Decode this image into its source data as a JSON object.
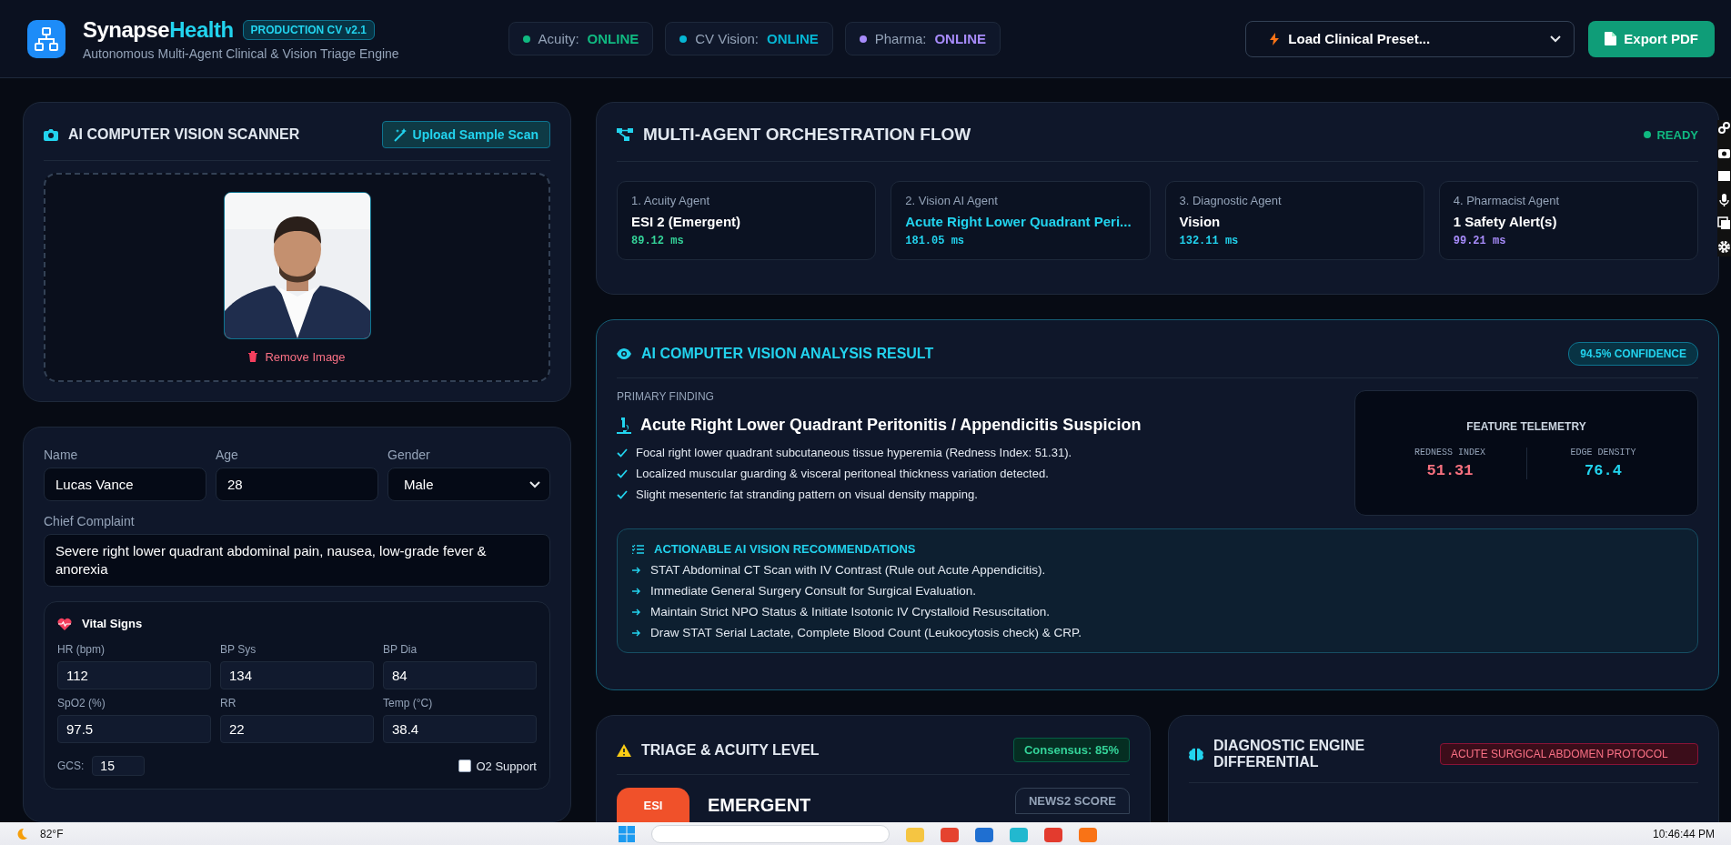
{
  "header": {
    "app_name_part1": "Synapse",
    "app_name_part2": "Health",
    "version_badge": "PRODUCTION CV v2.1",
    "subtitle": "Autonomous Multi-Agent Clinical & Vision Triage Engine"
  },
  "status_pills": [
    {
      "label": "Acuity:",
      "status": "ONLINE",
      "color": "#10b981"
    },
    {
      "label": "CV Vision:",
      "status": "ONLINE",
      "color": "#06b6d4"
    },
    {
      "label": "Pharma:",
      "status": "ONLINE",
      "color": "#a78bfa"
    }
  ],
  "preset_select": {
    "value": "Load Clinical Preset..."
  },
  "export_button": {
    "label": "Export PDF"
  },
  "scanner": {
    "title": "AI COMPUTER VISION SCANNER",
    "upload_button": "Upload Sample Scan",
    "remove_link": "Remove Image"
  },
  "patient_form": {
    "fields": [
      {
        "label": "Name",
        "value": "Lucas Vance",
        "kind": "text"
      },
      {
        "label": "Age",
        "value": "28",
        "kind": "text"
      },
      {
        "label": "Gender",
        "value": "Male",
        "kind": "select"
      }
    ],
    "chief_complaint": {
      "label": "Chief Complaint",
      "value": "Severe right lower quadrant abdominal pain, nausea, low-grade fever & anorexia"
    },
    "vitals": {
      "title": "Vital Signs",
      "fields": [
        {
          "label": "HR (bpm)",
          "value": "112"
        },
        {
          "label": "BP Sys",
          "value": "134"
        },
        {
          "label": "BP Dia",
          "value": "84"
        },
        {
          "label": "SpO2 (%)",
          "value": "97.5"
        },
        {
          "label": "RR",
          "value": "22"
        },
        {
          "label": "Temp (°C)",
          "value": "38.4"
        }
      ],
      "gcs": {
        "label": "GCS:",
        "value": "15"
      },
      "o2_support": {
        "label": "O2 Support",
        "checked": false
      }
    }
  },
  "orchestration": {
    "title": "MULTI-AGENT ORCHESTRATION FLOW",
    "status": "READY",
    "agents": [
      {
        "step": "1. Acuity Agent",
        "result": "ESI 2 (Emergent)",
        "latency": "89.12 ms",
        "color": "#34d399",
        "highlighted": false
      },
      {
        "step": "2. Vision AI Agent",
        "result": "Acute Right Lower Quadrant Peri...",
        "latency": "181.05 ms",
        "color": "#22d3ee",
        "highlighted": true
      },
      {
        "step": "3. Diagnostic Agent",
        "result": "Vision",
        "latency": "132.11 ms",
        "color": "#22d3ee",
        "highlighted": false
      },
      {
        "step": "4. Pharmacist Agent",
        "result": "1 Safety Alert(s)",
        "latency": "99.21 ms",
        "color": "#a78bfa",
        "highlighted": false
      }
    ]
  },
  "analysis": {
    "title": "AI COMPUTER VISION ANALYSIS RESULT",
    "confidence": "94.5% CONFIDENCE",
    "finding_label": "PRIMARY FINDING",
    "finding_title": "Acute Right Lower Quadrant Peritonitis / Appendicitis Suspicion",
    "observations": [
      "Focal right lower quadrant subcutaneous tissue hyperemia (Redness Index: 51.31).",
      "Localized muscular guarding & visceral peritoneal thickness variation detected.",
      "Slight mesenteric fat stranding pattern on visual density mapping."
    ],
    "telemetry": {
      "title": "FEATURE TELEMETRY",
      "metrics": [
        {
          "label": "REDNESS INDEX",
          "value": "51.31",
          "color": "#f8717f"
        },
        {
          "label": "EDGE DENSITY",
          "value": "76.4",
          "color": "#22d3ee"
        }
      ]
    },
    "recommendations": {
      "title": "ACTIONABLE AI VISION RECOMMENDATIONS",
      "items": [
        "STAT Abdominal CT Scan with IV Contrast (Rule out Acute Appendicitis).",
        "Immediate General Surgery Consult for Surgical Evaluation.",
        "Maintain Strict NPO Status & Initiate Isotonic IV Crystalloid Resuscitation.",
        "Draw STAT Serial Lactate, Complete Blood Count (Leukocytosis check) & CRP."
      ]
    }
  },
  "triage": {
    "title": "TRIAGE & ACUITY LEVEL",
    "consensus": "Consensus: 85%",
    "esi_badge": "ESI",
    "level": "EMERGENT",
    "news2_button": "NEWS2 SCORE"
  },
  "diagnostic": {
    "title": "DIAGNOSTIC ENGINE DIFFERENTIAL",
    "protocol_badge": "ACUTE SURGICAL ABDOMEN PROTOCOL"
  },
  "taskbar": {
    "weather": "82°F",
    "time": "10:46:44 PM"
  }
}
